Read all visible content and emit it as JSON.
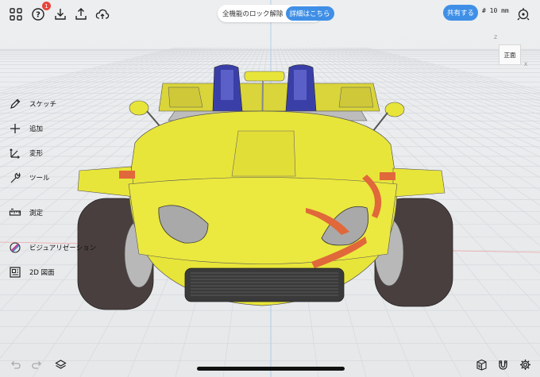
{
  "toolbar_left": {
    "items": [
      {
        "icon": "grid-menu-icon"
      },
      {
        "icon": "help-icon",
        "badge": "1"
      },
      {
        "icon": "import-icon"
      },
      {
        "icon": "export-icon"
      },
      {
        "icon": "cloud-upload-icon"
      }
    ]
  },
  "unlock_banner": {
    "text": "全機能のロック解除",
    "button_label": "詳細はこちら"
  },
  "toolbar_right": {
    "share_label": "共有する",
    "grid_size": "# 10 mm",
    "mode_icon": "snap-settings-icon"
  },
  "view_cube": {
    "face_label": "正面",
    "axis_z": "Z",
    "axis_x": "X"
  },
  "tools": [
    {
      "key": "sketch",
      "label": "スケッチ",
      "icon": "pen-icon"
    },
    {
      "key": "add",
      "label": "追加",
      "icon": "plus-icon"
    },
    {
      "key": "transform",
      "label": "変形",
      "icon": "transform-icon"
    },
    {
      "key": "tool",
      "label": "ツール",
      "icon": "wrench-icon"
    },
    {
      "key": "measure",
      "label": "測定",
      "icon": "ruler-icon"
    },
    {
      "key": "visualization",
      "label": "ビジュアリゼーション",
      "icon": "palette-icon"
    },
    {
      "key": "drawing",
      "label": "2D 図面",
      "icon": "drawing-icon"
    }
  ],
  "bottom": {
    "undo_icon": "undo-icon",
    "redo_icon": "redo-icon",
    "layers_icon": "layers-icon",
    "library_icon": "library-icon",
    "magnet_icon": "magnet-icon",
    "settings_icon": "gear-icon"
  },
  "colors": {
    "accent": "#3f8fe6",
    "badge": "#e8453c",
    "car_body": "#e8e53a",
    "seat": "#3a3fa8",
    "tire": "#4a3f3f",
    "stripe": "#e0683a"
  }
}
